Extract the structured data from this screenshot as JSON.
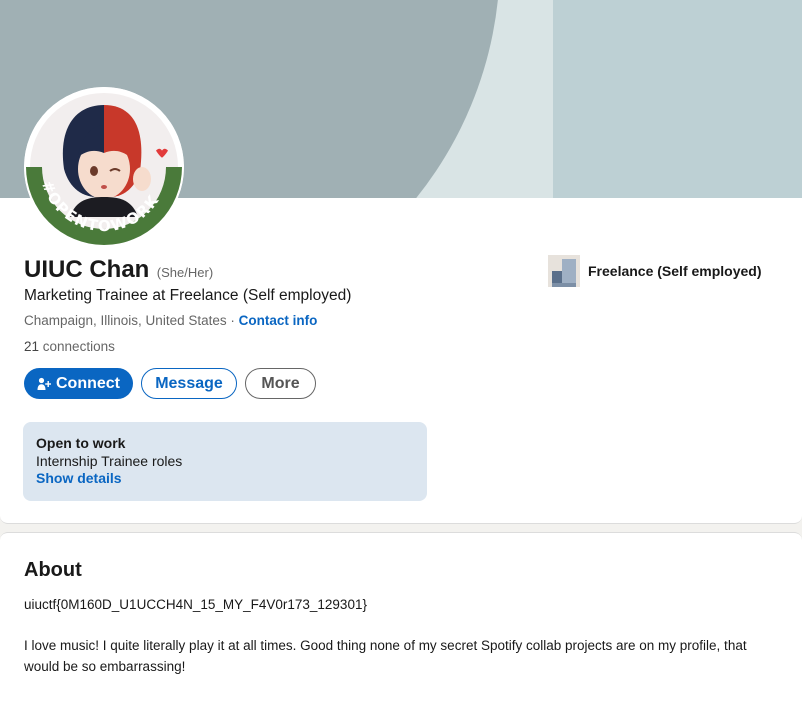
{
  "profile": {
    "name": "UIUC Chan",
    "pronouns": "(She/Her)",
    "headline": "Marketing Trainee at Freelance (Self employed)",
    "location": "Champaign, Illinois, United States",
    "location_separator": " · ",
    "contact_label": "Contact info",
    "connections_count": "21",
    "connections_label": " connections",
    "avatar_badge_text": "#OPENTOWORK"
  },
  "actions": {
    "connect_label": "Connect",
    "message_label": "Message",
    "more_label": "More"
  },
  "open_to_work": {
    "title": "Open to work",
    "roles": "Internship Trainee roles",
    "show_details": "Show details"
  },
  "experience": {
    "company": "Freelance (Self employed)"
  },
  "about": {
    "title": "About",
    "flag": "uiuctf{0M160D_U1UCCH4N_15_MY_F4V0r173_129301}",
    "body": "I love music! I quite literally play it at all times. Good thing none of my secret Spotify collab projects are on my profile, that would be so embarrassing!"
  },
  "colors": {
    "accent": "#0a66c2",
    "open_to_work_green": "#4a7a3a",
    "banner_light": "#d9e4e5",
    "banner_dark": "#a0b0b4"
  },
  "icons": {
    "connect": "add-person-icon"
  }
}
